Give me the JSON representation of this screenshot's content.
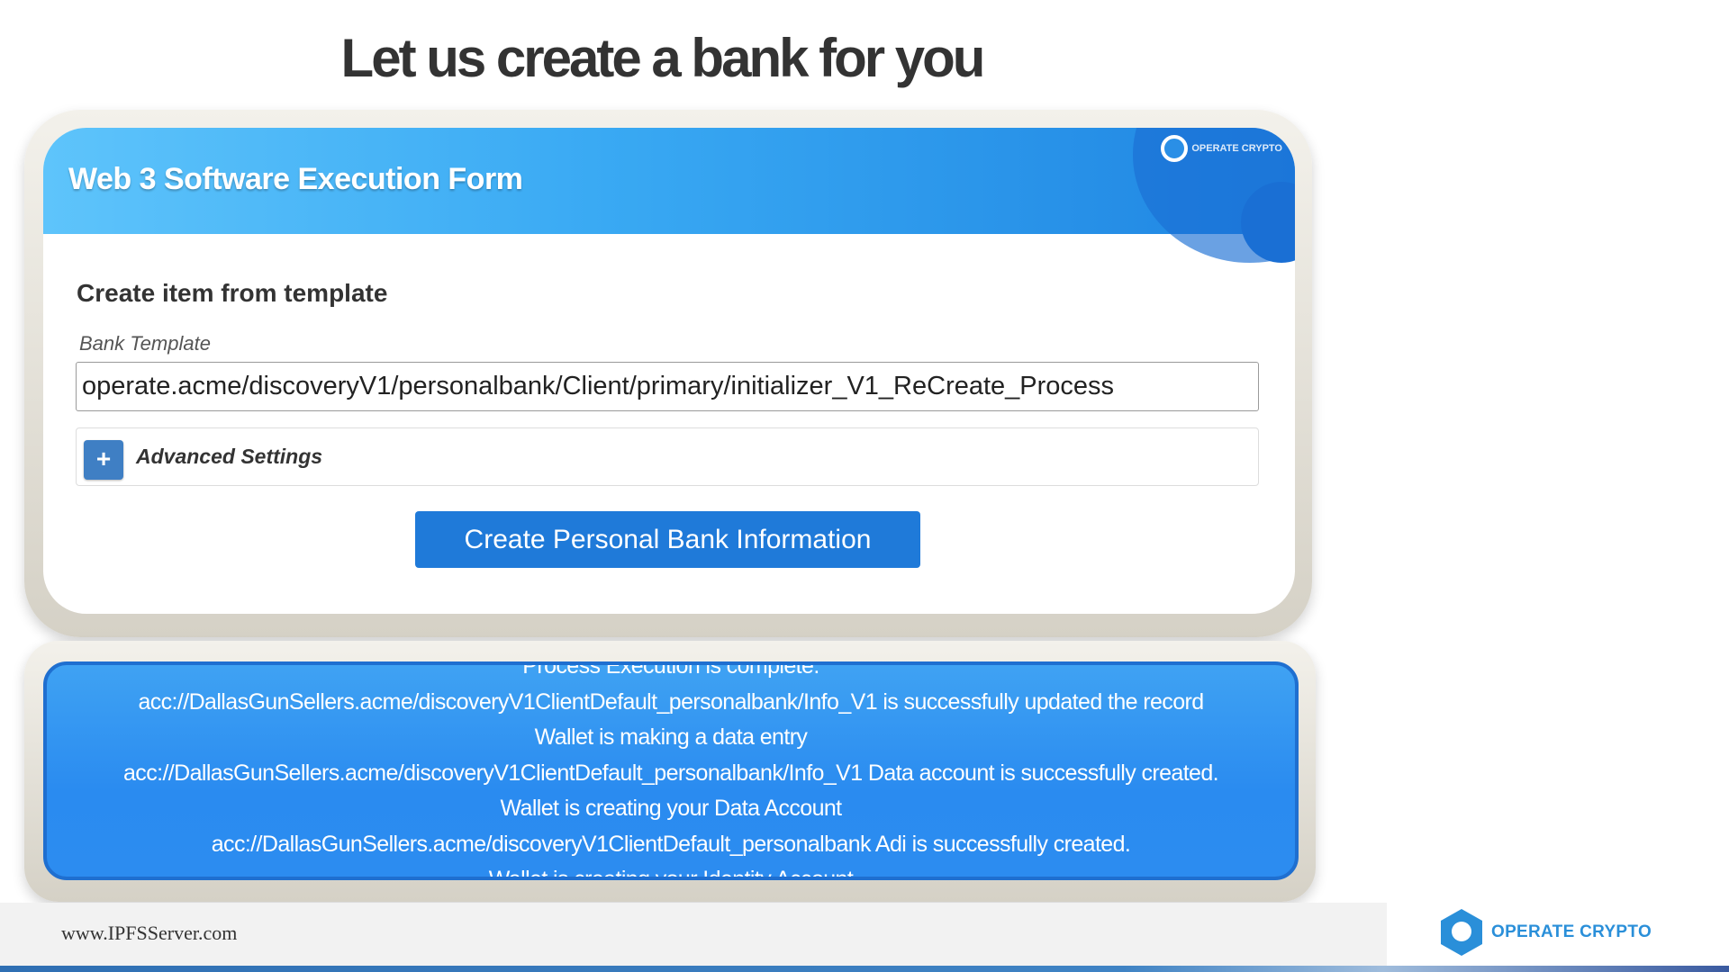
{
  "slide": {
    "title": "Let us create a bank for you"
  },
  "form": {
    "header_title": "Web 3 Software Execution Form",
    "header_logo_text": "OPERATE CRYPTO",
    "section_title": "Create item from template",
    "field_label": "Bank Template",
    "template_value": "operate.acme/discoveryV1/personalbank/Client/primary/initializer_V1_ReCreate_Process",
    "advanced_settings_label": "Advanced Settings",
    "expand_symbol": "+",
    "submit_label": "Create Personal Bank Information"
  },
  "log": {
    "lines": [
      "Process Execution is complete.",
      "acc://DallasGunSellers.acme/discoveryV1ClientDefault_personalbank/Info_V1 is successfully updated the record",
      "Wallet is making a data entry",
      "acc://DallasGunSellers.acme/discoveryV1ClientDefault_personalbank/Info_V1 Data account is successfully created.",
      "Wallet is creating your Data Account",
      "acc://DallasGunSellers.acme/discoveryV1ClientDefault_personalbank Adi is successfully created.",
      "Wallet is creating your Identity Account"
    ]
  },
  "footer": {
    "url": "www.IPFSServer.com",
    "logo_text": "OPERATE CRYPTO"
  },
  "colors": {
    "header_blue": "#39a9f3",
    "button_blue": "#1f7ad9",
    "log_blue": "#2a8bf0",
    "brand_blue": "#2a8fd9"
  },
  "icons": {
    "header_logo": "operate-crypto-logo-icon",
    "expand": "plus-icon",
    "footer_logo": "operate-crypto-hex-icon"
  }
}
